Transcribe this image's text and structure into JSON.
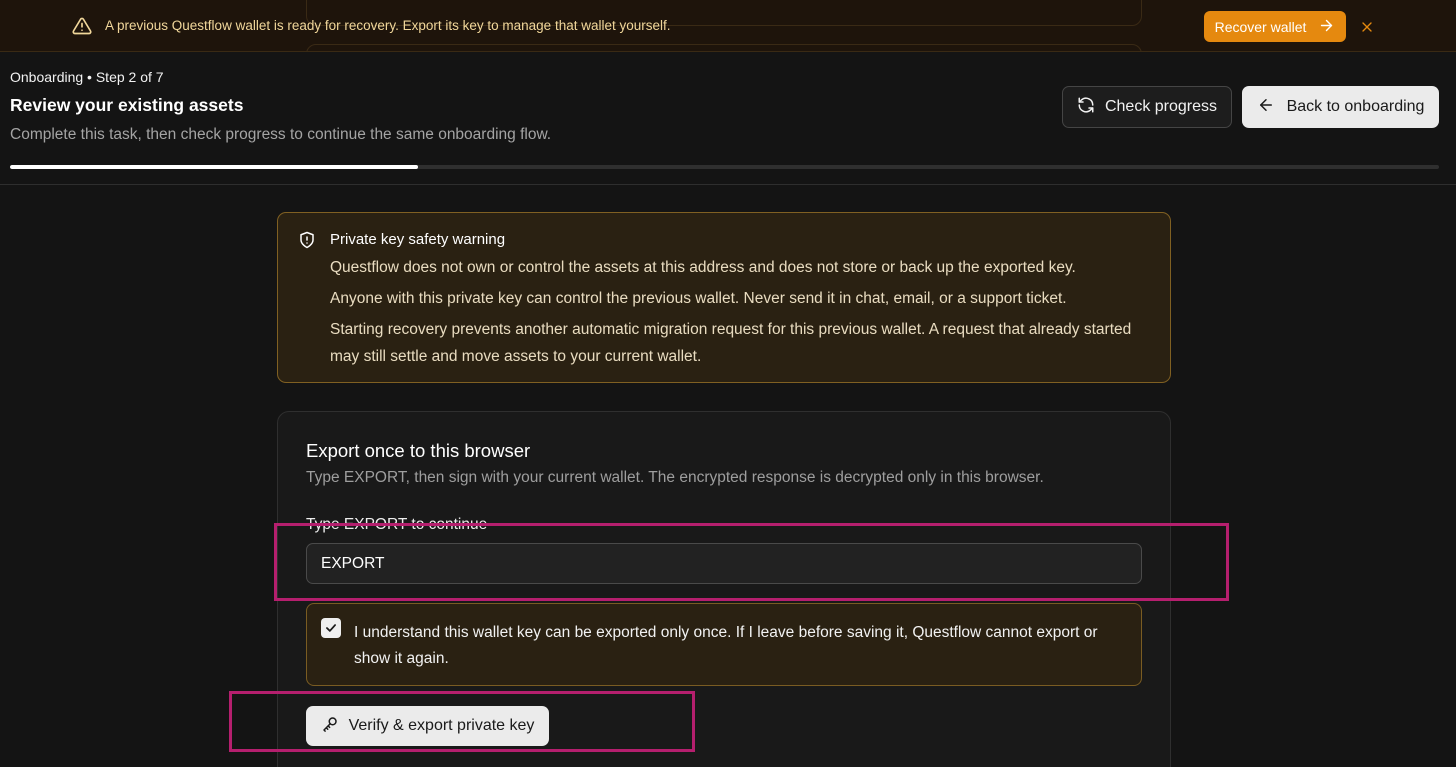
{
  "banner": {
    "message": "A previous Questflow wallet is ready for recovery. Export its key to manage that wallet yourself.",
    "recover_label": "Recover wallet",
    "warning_icon": "triangle-alert-icon",
    "arrow_icon": "arrow-right-icon",
    "close_icon": "close-icon"
  },
  "header": {
    "step_label": "Onboarding • Step 2 of 7",
    "title": "Review your existing assets",
    "subtitle": "Complete this task, then check progress to continue the same onboarding flow.",
    "check_progress_label": "Check progress",
    "back_label": "Back to onboarding",
    "progress_fraction": 0.2857
  },
  "warning": {
    "icon": "shield-alert-icon",
    "title": "Private key safety warning",
    "lines": [
      "Questflow does not own or control the assets at this address and does not store or back up the exported key.",
      "Anyone with this private key can control the previous wallet. Never send it in chat, email, or a support ticket.",
      "Starting recovery prevents another automatic migration request for this previous wallet. A request that already started may still settle and move assets to your current wallet."
    ]
  },
  "export": {
    "title": "Export once to this browser",
    "description": "Type EXPORT, then sign with your current wallet. The encrypted response is decrypted only in this browser.",
    "field_label": "Type EXPORT to continue",
    "input_value": "EXPORT",
    "acknowledgement": "I understand this wallet key can be exported only once. If I leave before saving it, Questflow cannot export or show it again.",
    "acknowledged": true,
    "button_label": "Verify & export private key",
    "button_icon": "key-icon"
  },
  "colors": {
    "accent_orange": "#e5890f",
    "warning_border": "#806022",
    "highlight": "#b51f6e"
  }
}
